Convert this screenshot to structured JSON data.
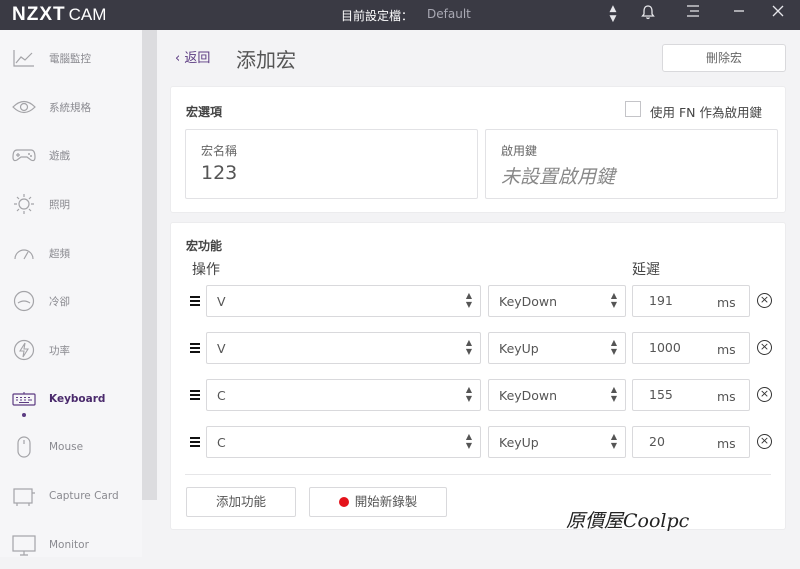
{
  "app": {
    "logo": "NZXT",
    "logo_suffix": "CAM",
    "profile_label": "目前設定檔：",
    "profile_value": "Default"
  },
  "sidebar": {
    "items": [
      {
        "label": "電腦監控",
        "icon": "chart-line-icon"
      },
      {
        "label": "系統規格",
        "icon": "eye-icon"
      },
      {
        "label": "遊戲",
        "icon": "gamepad-icon"
      },
      {
        "label": "照明",
        "icon": "sun-icon"
      },
      {
        "label": "超頻",
        "icon": "speedometer-icon"
      },
      {
        "label": "冷卻",
        "icon": "fan-icon"
      },
      {
        "label": "功率",
        "icon": "lightning-icon"
      },
      {
        "label": "Keyboard",
        "icon": "keyboard-icon",
        "active": true
      },
      {
        "label": "Mouse",
        "icon": "mouse-icon"
      },
      {
        "label": "Capture Card",
        "icon": "capture-card-icon"
      },
      {
        "label": "Monitor",
        "icon": "monitor-icon"
      }
    ]
  },
  "header": {
    "back_label": "返回",
    "title": "添加宏",
    "delete_label": "刪除宏"
  },
  "options": {
    "title": "宏選項",
    "fn_label": "使用 FN 作為啟用鍵",
    "name_label": "宏名稱",
    "name_value": "123",
    "key_label": "啟用鍵",
    "key_placeholder": "未設置啟用鍵"
  },
  "functions": {
    "title": "宏功能",
    "col_action": "操作",
    "col_delay": "延遲",
    "unit": "ms",
    "rows": [
      {
        "key": "V",
        "event": "KeyDown",
        "delay": "191"
      },
      {
        "key": "V",
        "event": "KeyUp",
        "delay": "1000"
      },
      {
        "key": "C",
        "event": "KeyDown",
        "delay": "155"
      },
      {
        "key": "C",
        "event": "KeyUp",
        "delay": "20"
      }
    ],
    "add_label": "添加功能",
    "record_label": "開始新錄製"
  },
  "watermark": "原價屋Coolpc",
  "colors": {
    "accent": "#5c3b82",
    "titlebar": "#3a3a44",
    "record": "#e4131b"
  }
}
